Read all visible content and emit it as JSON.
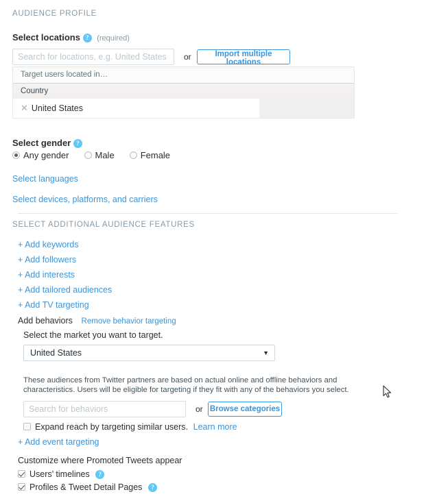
{
  "section_audience_profile": "AUDIENCE PROFILE",
  "locations": {
    "label": "Select locations",
    "help_icon": "question-help-icon",
    "required_note": "(required)",
    "search_placeholder": "Search for locations, e.g. United States",
    "search_value": "",
    "or": "or",
    "import_button": "Import multiple locations",
    "table": {
      "caption": "Target users located in…",
      "column_header": "Country",
      "rows": [
        {
          "remove_icon": "close-x-icon",
          "name": "United States"
        }
      ]
    }
  },
  "gender": {
    "label": "Select gender",
    "help_icon": "question-help-icon",
    "options": [
      {
        "label": "Any gender",
        "checked": true
      },
      {
        "label": "Male",
        "checked": false
      },
      {
        "label": "Female",
        "checked": false
      }
    ]
  },
  "links": {
    "languages": "Select languages",
    "devices": "Select devices, platforms, and carriers"
  },
  "section_additional_features": "SELECT ADDITIONAL AUDIENCE FEATURES",
  "features": [
    "+ Add keywords",
    "+ Add followers",
    "+ Add interests",
    "+ Add tailored audiences",
    "+ Add TV targeting"
  ],
  "behaviors": {
    "title": "Add behaviors",
    "remove_link": "Remove behavior targeting",
    "market_prompt": "Select the market you want to target.",
    "market_selected": "United States",
    "market_caret": "chevron-down-icon",
    "description": "These audiences from Twitter partners are based on actual online and offline behaviors and characteristics. Users will be eligible for targeting if they fit with any of the behaviors you select.",
    "search_placeholder": "Search for behaviors",
    "search_value": "",
    "or": "or",
    "browse_button": "Browse categories",
    "expand_reach": {
      "checked": false,
      "label": "Expand reach by targeting similar users.",
      "learn_more": "Learn more"
    }
  },
  "add_event_targeting": "+ Add event targeting",
  "placement": {
    "title": "Customize where Promoted Tweets appear",
    "options": [
      {
        "label": "Users’ timelines",
        "checked": true,
        "help_icon": "question-help-icon"
      },
      {
        "label": "Profiles & Tweet Detail Pages",
        "checked": true,
        "help_icon": "question-help-icon"
      }
    ]
  },
  "colors": {
    "link": "#3b94d9",
    "help_badge": "#5fc8f4",
    "muted": "#8899a6",
    "text": "#292f33",
    "border": "#ccd6dd"
  }
}
